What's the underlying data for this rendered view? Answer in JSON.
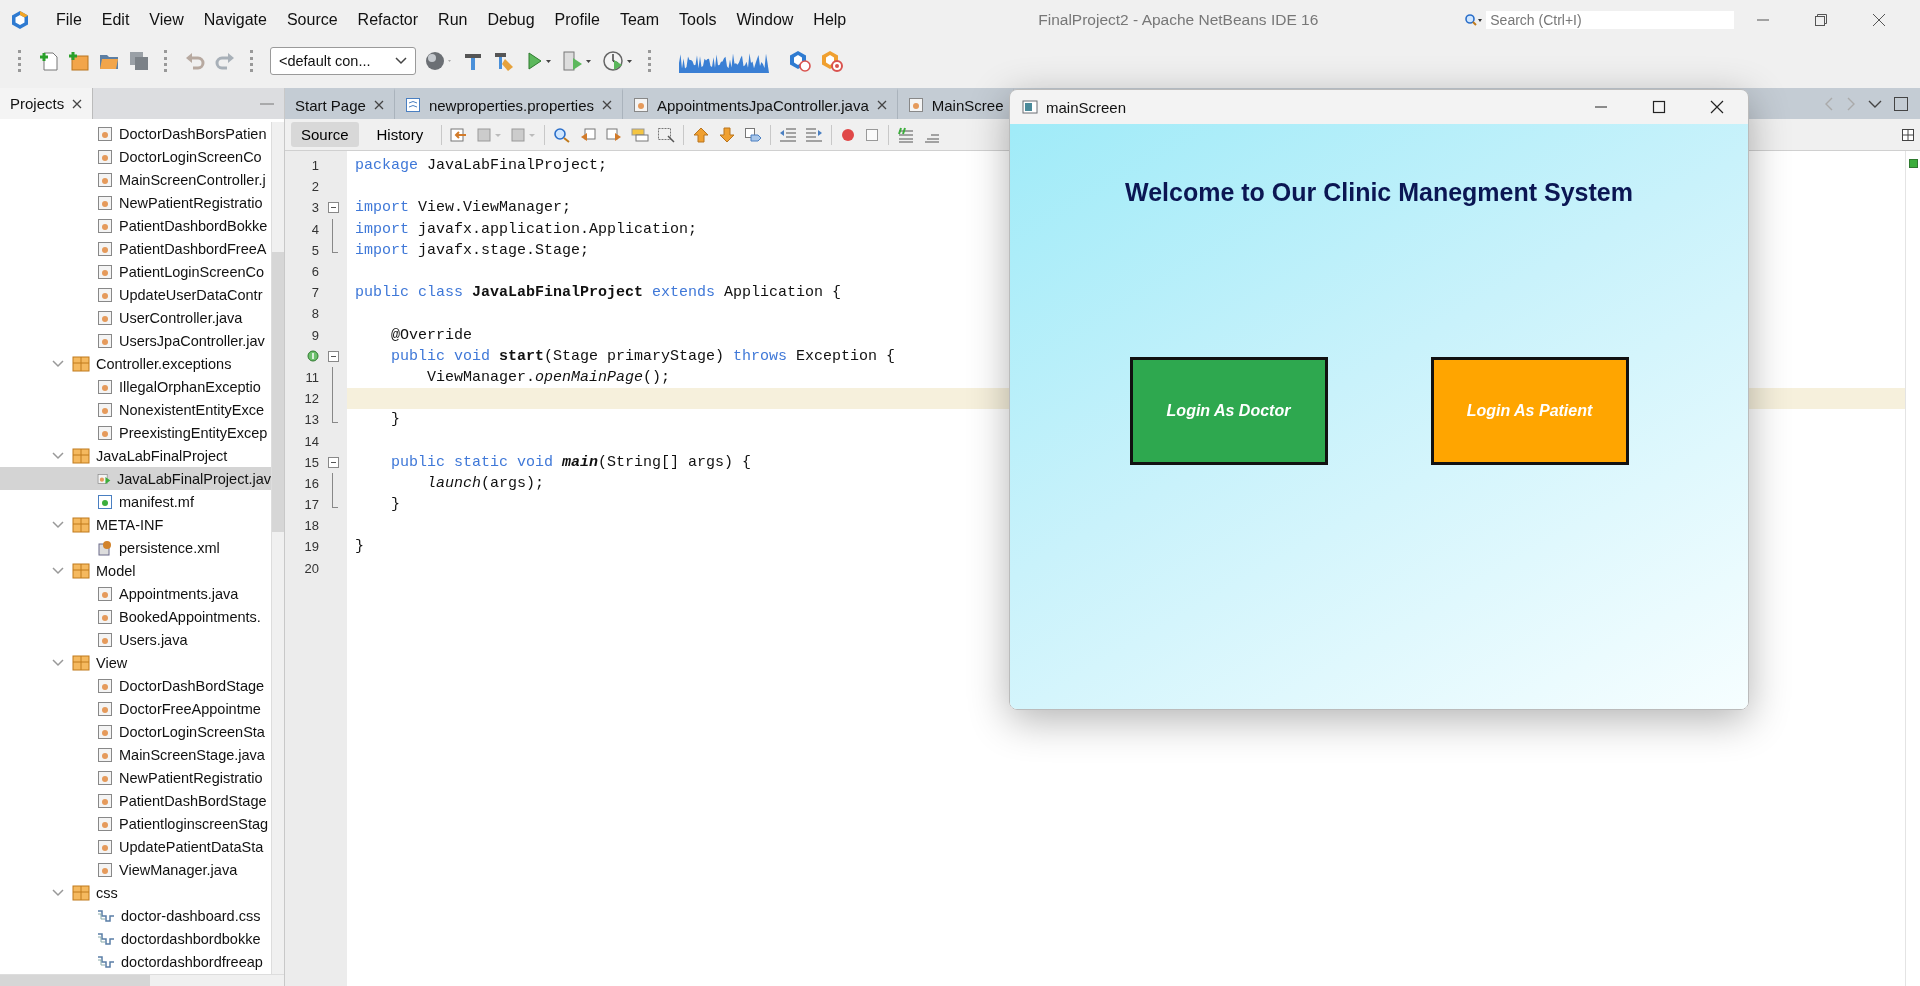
{
  "window": {
    "title": "FinalProject2 - Apache NetBeans IDE 16"
  },
  "menu": [
    "File",
    "Edit",
    "View",
    "Navigate",
    "Source",
    "Refactor",
    "Run",
    "Debug",
    "Profile",
    "Team",
    "Tools",
    "Window",
    "Help"
  ],
  "search": {
    "placeholder": "Search (Ctrl+I)"
  },
  "config_dropdown": {
    "value": "<default con..."
  },
  "projects_panel": {
    "tab": "Projects",
    "tree": [
      {
        "kind": "group",
        "children": [
          {
            "kind": "java",
            "label": "DoctorDashBorsPatien",
            "selected": false
          },
          {
            "kind": "java",
            "label": "DoctorLoginScreenCo",
            "selected": false
          },
          {
            "kind": "java",
            "label": "MainScreenController.j",
            "selected": false
          },
          {
            "kind": "java",
            "label": "NewPatientRegistratio",
            "selected": false
          },
          {
            "kind": "java",
            "label": "PatientDashbordBokke",
            "selected": false
          },
          {
            "kind": "java",
            "label": "PatientDashbordFreeA",
            "selected": false
          },
          {
            "kind": "java",
            "label": "PatientLoginScreenCo",
            "selected": false
          },
          {
            "kind": "java",
            "label": "UpdateUserDataContr",
            "selected": false
          },
          {
            "kind": "java",
            "label": "UserController.java",
            "selected": false
          },
          {
            "kind": "java",
            "label": "UsersJpaController.jav",
            "selected": false
          }
        ]
      },
      {
        "kind": "package",
        "label": "Controller.exceptions",
        "expanded": true,
        "selected": false,
        "children": [
          {
            "kind": "java",
            "label": "IllegalOrphanExceptio",
            "selected": false
          },
          {
            "kind": "java",
            "label": "NonexistentEntityExce",
            "selected": false
          },
          {
            "kind": "java",
            "label": "PreexistingEntityExcep",
            "selected": false
          }
        ]
      },
      {
        "kind": "package",
        "label": "JavaLabFinalProject",
        "expanded": true,
        "selected": false,
        "children": [
          {
            "kind": "java-main",
            "label": "JavaLabFinalProject.jav",
            "selected": true
          },
          {
            "kind": "manifest",
            "label": "manifest.mf",
            "selected": false
          }
        ]
      },
      {
        "kind": "package",
        "label": "META-INF",
        "expanded": true,
        "selected": false,
        "children": [
          {
            "kind": "xml",
            "label": "persistence.xml",
            "selected": false
          }
        ]
      },
      {
        "kind": "package",
        "label": "Model",
        "expanded": true,
        "selected": false,
        "children": [
          {
            "kind": "java",
            "label": "Appointments.java",
            "selected": false
          },
          {
            "kind": "java",
            "label": "BookedAppointments.",
            "selected": false
          },
          {
            "kind": "java",
            "label": "Users.java",
            "selected": false
          }
        ]
      },
      {
        "kind": "package",
        "label": "View",
        "expanded": true,
        "selected": false,
        "children": [
          {
            "kind": "java",
            "label": "DoctorDashBordStage",
            "selected": false
          },
          {
            "kind": "java",
            "label": "DoctorFreeAppointme",
            "selected": false
          },
          {
            "kind": "java",
            "label": "DoctorLoginScreenSta",
            "selected": false
          },
          {
            "kind": "java",
            "label": "MainScreenStage.java",
            "selected": false
          },
          {
            "kind": "java",
            "label": "NewPatientRegistratio",
            "selected": false
          },
          {
            "kind": "java",
            "label": "PatientDashBordStage",
            "selected": false
          },
          {
            "kind": "java",
            "label": "PatientloginscreenStag",
            "selected": false
          },
          {
            "kind": "java",
            "label": "UpdatePatientDataSta",
            "selected": false
          },
          {
            "kind": "java",
            "label": "ViewManager.java",
            "selected": false
          }
        ]
      },
      {
        "kind": "package",
        "label": "css",
        "expanded": true,
        "selected": false,
        "children": [
          {
            "kind": "css",
            "label": "doctor-dashboard.css",
            "selected": false
          },
          {
            "kind": "css",
            "label": "doctordashbordbokke",
            "selected": false
          },
          {
            "kind": "css",
            "label": "doctordashbordfreeap",
            "selected": false
          }
        ]
      }
    ]
  },
  "editor_tabs": [
    {
      "kind": "page",
      "label": "Start Page",
      "selected": false,
      "closable": true
    },
    {
      "kind": "properties",
      "label": "newproperties.properties",
      "selected": false,
      "closable": true
    },
    {
      "kind": "java",
      "label": "AppointmentsJpaController.java",
      "selected": false,
      "closable": true
    },
    {
      "kind": "java",
      "label": "MainScree",
      "selected": false,
      "closable": false
    }
  ],
  "view_tabs": [
    {
      "label": "Source",
      "selected": true
    },
    {
      "label": "History",
      "selected": false
    }
  ],
  "code": [
    {
      "number": "1",
      "highlighted": false,
      "tokens": [
        {
          "kind": "kw",
          "text": "package"
        },
        {
          "kind": "plain",
          "text": " JavaLabFinalProject;"
        }
      ]
    },
    {
      "number": "2",
      "highlighted": false
    },
    {
      "number": "3",
      "highlighted": false,
      "kind": "fold-open",
      "tokens": [
        {
          "kind": "kw",
          "text": "import"
        },
        {
          "kind": "plain",
          "text": " View.ViewManager;"
        }
      ]
    },
    {
      "number": "4",
      "highlighted": false,
      "kind": "fold-bar",
      "tokens": [
        {
          "kind": "kw",
          "text": "import"
        },
        {
          "kind": "plain",
          "text": " javafx.application.Application;"
        }
      ]
    },
    {
      "number": "5",
      "highlighted": false,
      "kind": "fold-end",
      "tokens": [
        {
          "kind": "kw",
          "text": "import"
        },
        {
          "kind": "plain",
          "text": " javafx.stage.Stage;"
        }
      ]
    },
    {
      "number": "6",
      "highlighted": false
    },
    {
      "number": "7",
      "highlighted": false,
      "tokens": [
        {
          "kind": "kw",
          "text": "public class"
        },
        {
          "kind": "bold",
          "text": " JavaLabFinalProject"
        },
        {
          "kind": "kw",
          "text": " extends"
        },
        {
          "kind": "plain",
          "text": " Application {"
        }
      ]
    },
    {
      "number": "8",
      "highlighted": false
    },
    {
      "number": "9",
      "highlighted": false,
      "tokens": [
        {
          "kind": "plain",
          "text": "    @Override"
        }
      ]
    },
    {
      "highlighted": false,
      "kind": "fold-open",
      "override": true,
      "tokens": [
        {
          "kind": "kw",
          "text": "    public void"
        },
        {
          "kind": "bold",
          "text": " start"
        },
        {
          "kind": "plain",
          "text": "(Stage primaryStage)"
        },
        {
          "kind": "kw",
          "text": " throws"
        },
        {
          "kind": "plain",
          "text": " Exception {"
        }
      ]
    },
    {
      "number": "11",
      "highlighted": false,
      "kind": "fold-bar",
      "tokens": [
        {
          "kind": "plain",
          "text": "        ViewManager."
        },
        {
          "kind": "italic",
          "text": "openMainPage"
        },
        {
          "kind": "plain",
          "text": "();"
        }
      ]
    },
    {
      "number": "12",
      "highlighted": true,
      "kind": "fold-bar"
    },
    {
      "number": "13",
      "highlighted": false,
      "kind": "fold-end",
      "tokens": [
        {
          "kind": "plain",
          "text": "    }"
        }
      ]
    },
    {
      "number": "14",
      "highlighted": false
    },
    {
      "number": "15",
      "highlighted": false,
      "kind": "fold-open",
      "tokens": [
        {
          "kind": "kw",
          "text": "    public static void"
        },
        {
          "kind": "bold-italic",
          "text": " main"
        },
        {
          "kind": "plain",
          "text": "(String[] args) {"
        }
      ]
    },
    {
      "number": "16",
      "highlighted": false,
      "kind": "fold-bar",
      "tokens": [
        {
          "kind": "italic",
          "text": "        launch"
        },
        {
          "kind": "plain",
          "text": "(args);"
        }
      ]
    },
    {
      "number": "17",
      "highlighted": false,
      "kind": "fold-end",
      "tokens": [
        {
          "kind": "plain",
          "text": "    }"
        }
      ]
    },
    {
      "number": "18",
      "highlighted": false
    },
    {
      "number": "19",
      "highlighted": false,
      "tokens": [
        {
          "kind": "plain",
          "text": "}"
        }
      ]
    },
    {
      "number": "20",
      "highlighted": false
    }
  ],
  "app_window": {
    "title": "mainScreen",
    "heading": "Welcome to Our Clinic Manegment System",
    "buttons": [
      {
        "label": "Login As Doctor",
        "color": "#2ea84f"
      },
      {
        "label": "Login As Patient",
        "color": "#ffa500"
      }
    ]
  }
}
